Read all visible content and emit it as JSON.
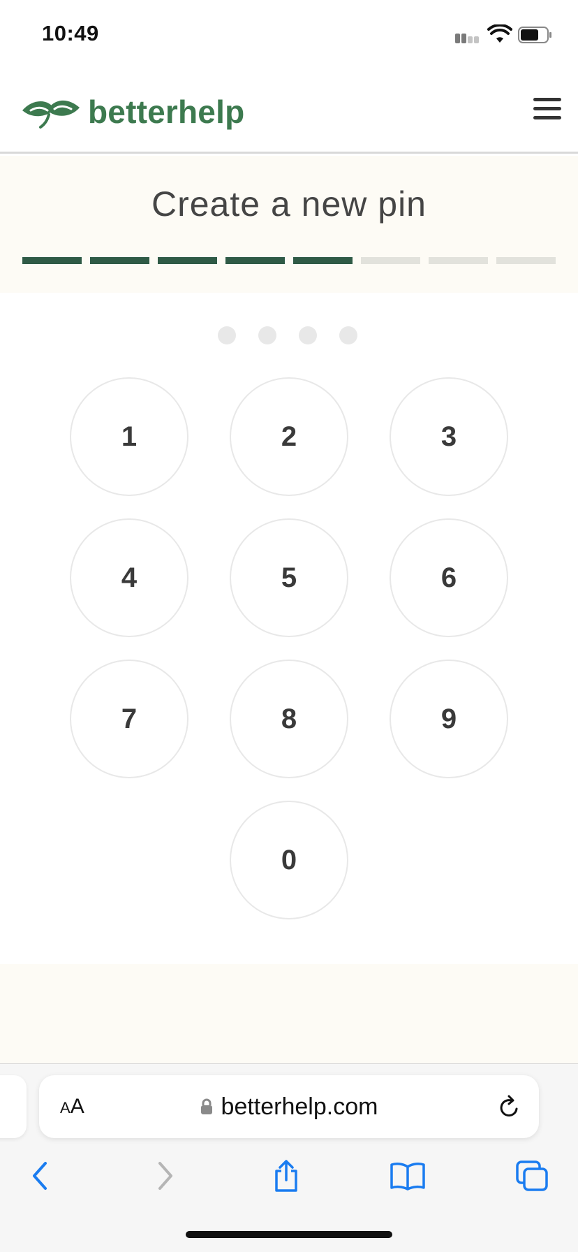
{
  "status_bar": {
    "time": "10:49",
    "icons": [
      "cellular-signal-icon",
      "wifi-icon",
      "battery-icon"
    ]
  },
  "header": {
    "brand_name": "betterhelp",
    "logo_icon": "hands-leaf-logo-icon",
    "menu_icon": "hamburger-menu-icon"
  },
  "pin_setup": {
    "title": "Create a new pin",
    "progress": {
      "total_steps": 8,
      "completed_steps": 5
    },
    "entered_digits": 0,
    "pin_length": 4
  },
  "keypad": {
    "keys": [
      "1",
      "2",
      "3",
      "4",
      "5",
      "6",
      "7",
      "8",
      "9",
      "0"
    ]
  },
  "browser": {
    "text_size_label_small": "A",
    "text_size_label_large": "A",
    "url": "betterhelp.com",
    "nav_icons": [
      "back-arrow-icon",
      "forward-arrow-icon",
      "share-icon",
      "bookmarks-icon",
      "tabs-icon"
    ]
  },
  "colors": {
    "brand_green": "#3d7a4f",
    "progress_done": "#2f5a46",
    "progress_todo": "#e2e2dc",
    "cream_bg": "#fdfbf5",
    "safari_blue": "#1a7cf0"
  }
}
